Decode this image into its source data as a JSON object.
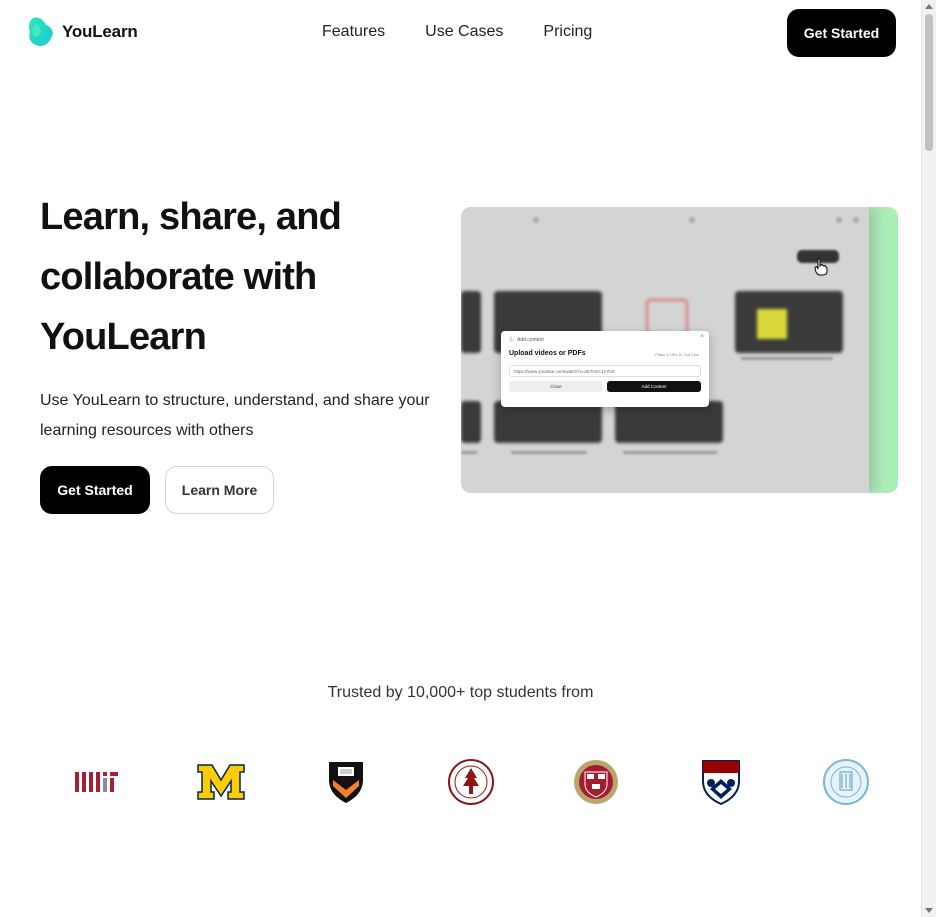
{
  "header": {
    "brand": "YouLearn",
    "nav": [
      "Features",
      "Use Cases",
      "Pricing"
    ],
    "cta_label": "Get Started"
  },
  "hero": {
    "title": "Learn, share, and collaborate with YouLearn",
    "subtitle": "Use YouLearn to structure, understand, and share your learning resources with others",
    "primary_label": "Get Started",
    "secondary_label": "Learn More"
  },
  "preview": {
    "modal_header": "Add content",
    "modal_title": "Upload videos or PDFs",
    "modal_hint": "Paste a URL to YouTube",
    "modal_input": "https://www.youtube.com/watch?v=aE7HXc1YYhZ",
    "modal_close": "Close",
    "modal_add": "Add Content"
  },
  "trusted": {
    "label": "Trusted by 10,000+ top students from",
    "logos": [
      "mit-logo",
      "michigan-logo",
      "princeton-logo",
      "stanford-logo",
      "harvard-logo",
      "penn-logo",
      "ucsd-logo"
    ]
  },
  "colors": {
    "accent_green": "#34d399",
    "accent_teal": "#2dd4bf",
    "primary_button": "#000000"
  }
}
